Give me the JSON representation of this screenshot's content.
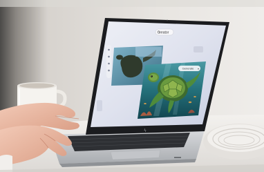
{
  "photo": {
    "subject": "Person typing on a laptop showing an AI image-generation app with a sea turtle",
    "screen_app": {
      "top_button_label": "Creator",
      "preview_pill_label": "Generate"
    },
    "colors": {
      "background_wall": "#e6e3df",
      "table": "#f1efec",
      "laptop_silver": "#c8cacd",
      "screen_bg": "#d9dbe6",
      "sea_teal": "#1f6e72",
      "turtle_green": "#4f8b3b",
      "mug": "#f4f2ee"
    }
  }
}
